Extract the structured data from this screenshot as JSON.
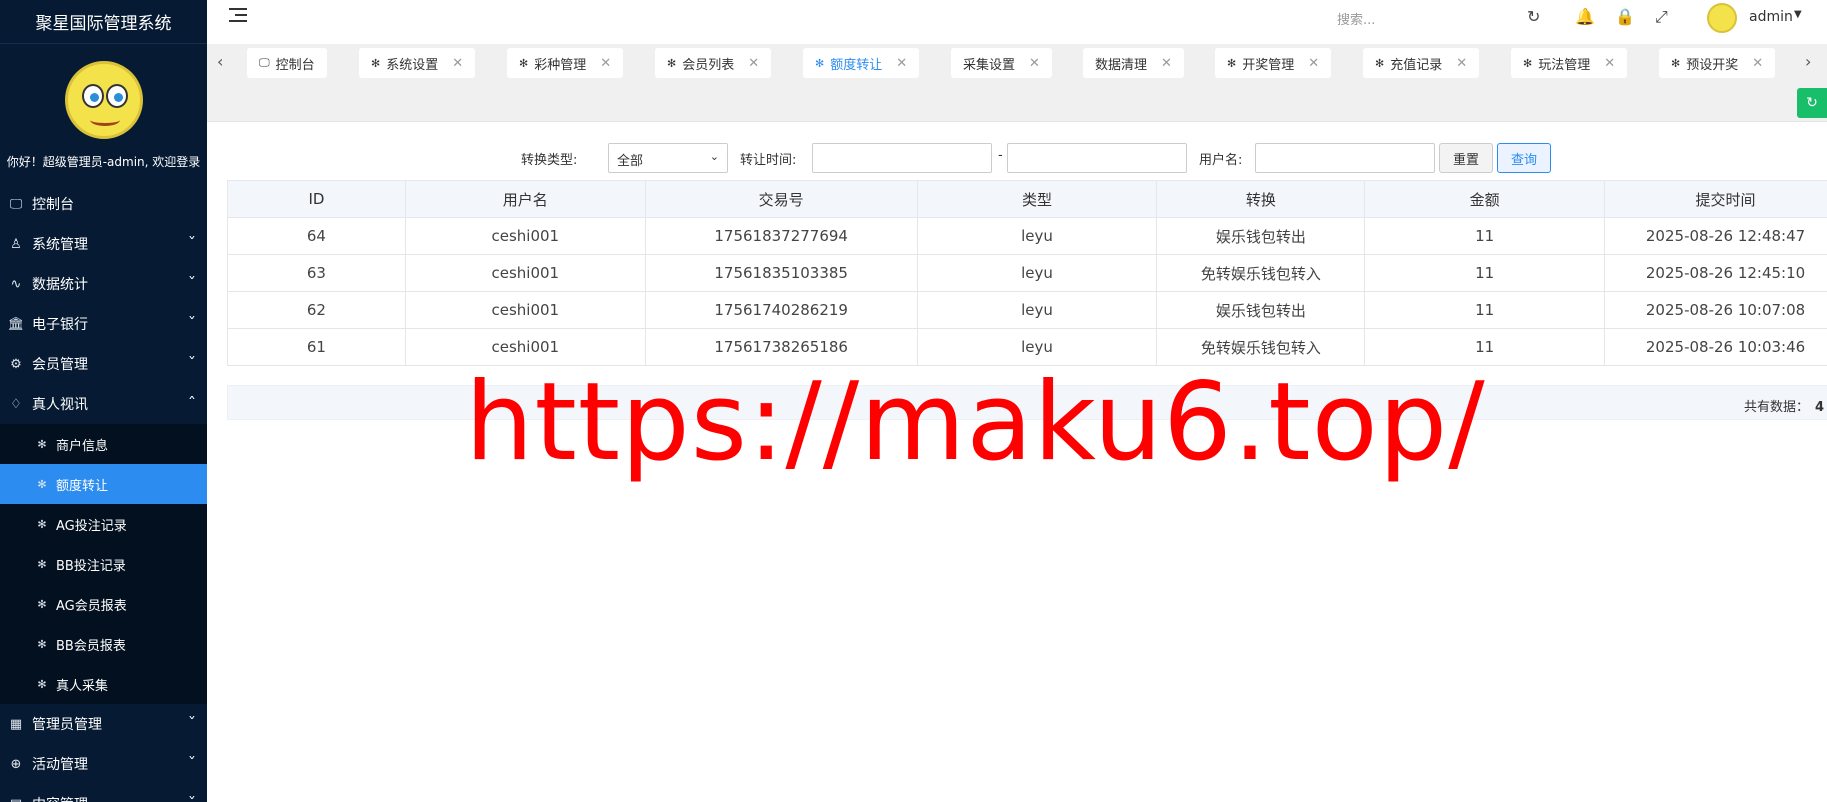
{
  "app_title": "聚星国际管理系统",
  "welcome": "你好！超级管理员-admin, 欢迎登录",
  "sidebar": {
    "items": [
      {
        "label": "控制台",
        "icon": "monitor-icon"
      },
      {
        "label": "系统管理",
        "icon": "user-icon"
      },
      {
        "label": "数据统计",
        "icon": "pulse-icon"
      },
      {
        "label": "电子银行",
        "icon": "bank-icon"
      },
      {
        "label": "会员管理",
        "icon": "gear-icon"
      },
      {
        "label": "真人视讯",
        "icon": "drop-icon"
      },
      {
        "label": "管理员管理",
        "icon": "grid-icon"
      },
      {
        "label": "活动管理",
        "icon": "plus-circle-icon"
      },
      {
        "label": "内容管理",
        "icon": "doc-icon"
      }
    ],
    "submenu": [
      {
        "label": "商户信息"
      },
      {
        "label": "额度转让"
      },
      {
        "label": "AG投注记录"
      },
      {
        "label": "BB投注记录"
      },
      {
        "label": "AG会员报表"
      },
      {
        "label": "BB会员报表"
      },
      {
        "label": "真人采集"
      }
    ]
  },
  "topbar": {
    "search_placeholder": "搜索...",
    "username": "admin"
  },
  "tabs": [
    {
      "label": "控制台",
      "closable": false
    },
    {
      "label": "系统设置",
      "closable": true
    },
    {
      "label": "彩种管理",
      "closable": true
    },
    {
      "label": "会员列表",
      "closable": true
    },
    {
      "label": "额度转让",
      "closable": true
    },
    {
      "label": "采集设置",
      "closable": true
    },
    {
      "label": "数据清理",
      "closable": true
    },
    {
      "label": "开奖管理",
      "closable": true
    },
    {
      "label": "充值记录",
      "closable": true
    },
    {
      "label": "玩法管理",
      "closable": true
    },
    {
      "label": "预设开奖",
      "closable": true
    }
  ],
  "filter": {
    "type_label": "转换类型:",
    "type_value": "全部",
    "time_label": "转让时间:",
    "dash": "-",
    "user_label": "用户名:",
    "reset": "重置",
    "query": "查询"
  },
  "table": {
    "headers": [
      "ID",
      "用户名",
      "交易号",
      "类型",
      "转换",
      "金额",
      "提交时间"
    ],
    "rows": [
      [
        "64",
        "ceshi001",
        "17561837277694",
        "leyu",
        "娱乐钱包转出",
        "11",
        "2025-08-26 12:48:47"
      ],
      [
        "63",
        "ceshi001",
        "17561835103385",
        "leyu",
        "免转娱乐钱包转入",
        "11",
        "2025-08-26 12:45:10"
      ],
      [
        "62",
        "ceshi001",
        "17561740286219",
        "leyu",
        "娱乐钱包转出",
        "11",
        "2025-08-26 10:07:08"
      ],
      [
        "61",
        "ceshi001",
        "17561738265186",
        "leyu",
        "免转娱乐钱包转入",
        "11",
        "2025-08-26 10:03:46"
      ]
    ]
  },
  "footer": {
    "total_label": "共有数据：",
    "total_value": "4"
  },
  "watermark": "https://maku6.top/",
  "colors": {
    "sidebar_bg": "#061a33",
    "active": "#2d8cf0",
    "watermark": "#ff0000"
  }
}
